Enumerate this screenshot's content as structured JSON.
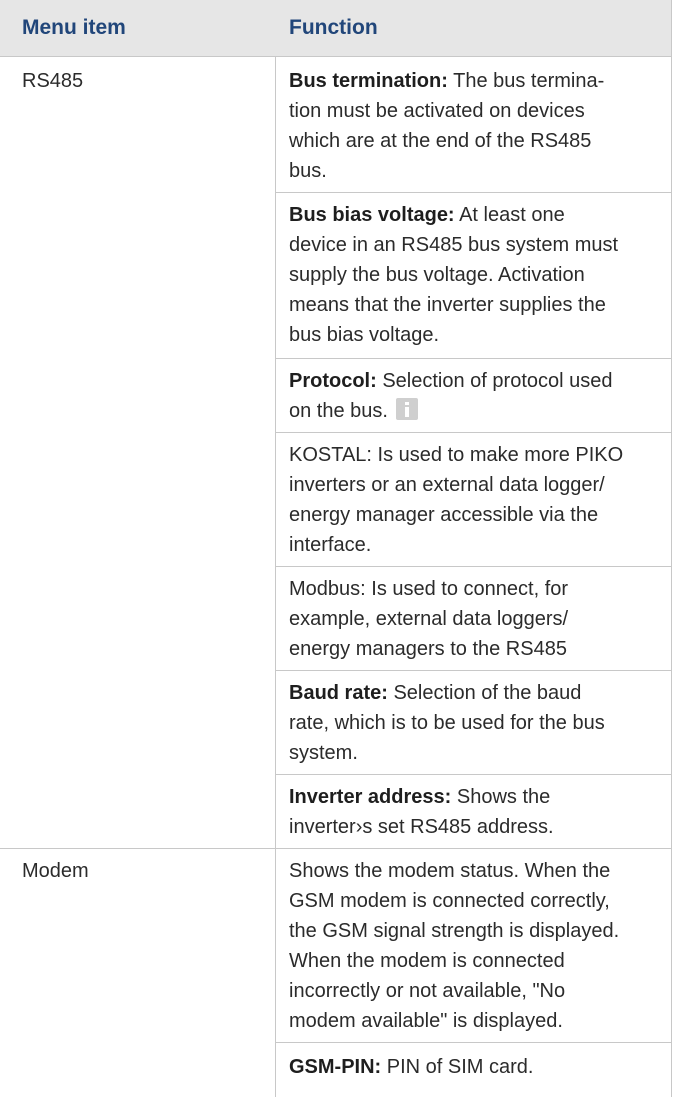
{
  "table": {
    "headers": {
      "col1": "Menu item",
      "col2": "Function"
    },
    "rows": [
      {
        "menu_item": "RS485",
        "entries": [
          {
            "bold": "Bus termination:",
            "lines": [
              " The bus termina-",
              "tion must be activated on devices",
              "which are at the end of the RS485",
              "bus."
            ]
          },
          {
            "bold": "Bus bias voltage:",
            "lines": [
              " At least one",
              "device in an RS485 bus system must",
              "supply the bus voltage. Activation",
              "means that the inverter supplies the",
              "bus bias voltage."
            ]
          },
          {
            "bold": "Protocol:",
            "lines": [
              " Selection of protocol used",
              "on the bus."
            ],
            "icon": "info-icon"
          },
          {
            "bold": "",
            "lines": [
              "KOSTAL: Is used to make more PIKO",
              "inverters or an external data logger/",
              "energy manager accessible via the",
              "interface."
            ]
          },
          {
            "bold": "",
            "lines": [
              "Modbus: Is used to connect, for",
              "example, external data loggers/",
              "energy managers to the RS485"
            ]
          },
          {
            "bold": "Baud rate:",
            "lines": [
              " Selection of the baud",
              "rate, which is to be used for the bus",
              "system."
            ]
          },
          {
            "bold": "Inverter address:",
            "lines": [
              " Shows the",
              "inverter›s set RS485 address."
            ]
          }
        ]
      },
      {
        "menu_item": "Modem",
        "entries": [
          {
            "bold": "",
            "lines": [
              "Shows the modem status. When the",
              "GSM modem is connected correctly,",
              "the GSM signal strength is displayed.",
              "When the modem is connected",
              "incorrectly or not available, \"No",
              "modem available\" is displayed."
            ]
          },
          {
            "bold": "GSM-PIN:",
            "lines": [
              " PIN of SIM card."
            ]
          }
        ]
      }
    ]
  }
}
